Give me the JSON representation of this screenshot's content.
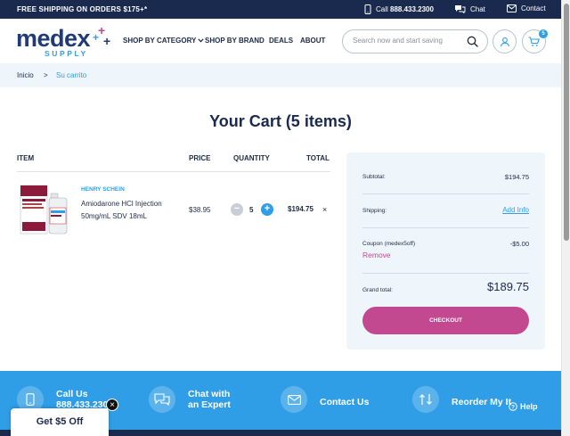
{
  "topbar": {
    "promo": "FREE SHIPPING ON ORDERS $175+*",
    "call_label": "Call",
    "call_number": "888.433.2300",
    "chat": "Chat",
    "contact": "Contact"
  },
  "logo": {
    "word": "medex",
    "sub": "SUPPLY"
  },
  "nav": {
    "category": "SHOP BY CATEGORY",
    "brand": "SHOP BY BRAND",
    "deals": "DEALS",
    "about": "ABOUT"
  },
  "search": {
    "placeholder": "Search now and start saving"
  },
  "cart_badge": "5",
  "breadcrumb": {
    "home": "Inicio",
    "separator": ">",
    "current": "Su carrito"
  },
  "cart": {
    "title": "Your Cart (5 items)",
    "headers": {
      "item": "ITEM",
      "price": "PRICE",
      "quantity": "QUANTITY",
      "total": "TOTAL"
    },
    "items": [
      {
        "brand": "HENRY SCHEIN",
        "name": "Amiodarone HCl Injection 50mg/mL SDV 18mL",
        "price": "$38.95",
        "quantity": "5",
        "total": "$194.75",
        "remove": "×"
      }
    ]
  },
  "summary": {
    "subtotal_label": "Subtotal:",
    "subtotal_value": "$194.75",
    "shipping_label": "Shipping:",
    "shipping_link": "Add Info",
    "coupon_label": "Coupon (medex5off)",
    "coupon_value": "-$5.00",
    "coupon_remove": "Remove",
    "grand_label": "Grand total:",
    "grand_value": "$189.75",
    "checkout": "CHECKOUT"
  },
  "footer": {
    "call_line1": "Call Us",
    "call_line2": "888.433.2300",
    "chat_line1": "Chat with",
    "chat_line2": "an Expert",
    "contact": "Contact Us",
    "reorder": "Reorder My It"
  },
  "promo_popup": {
    "label": "Get $5 Off",
    "close": "×"
  },
  "help": "Help",
  "colors": {
    "navy": "#1a2a4f",
    "blue": "#2f9ee6",
    "magenta": "#c2498f",
    "light_bg": "#eef5fb"
  }
}
